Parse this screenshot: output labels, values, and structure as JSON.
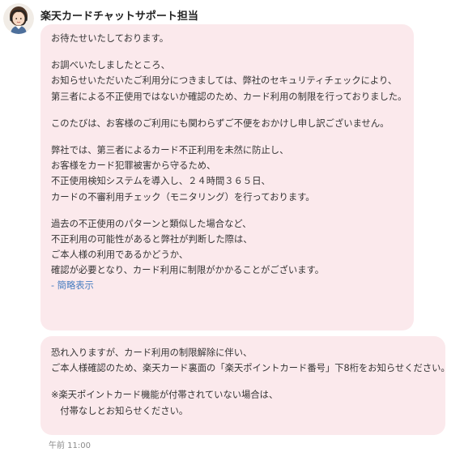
{
  "agent": {
    "name": "楽天カードチャットサポート担当",
    "avatar_icon": "support-agent-avatar-icon"
  },
  "messages": [
    {
      "paragraphs": [
        [
          "お待たせいたしております。"
        ],
        [
          "お調べいたしましたところ、",
          "お知らせいただいたご利用分につきましては、弊社のセキュリティチェックにより、",
          "第三者による不正使用ではないか確認のため、カード利用の制限を行っておりました。"
        ],
        [
          "このたびは、お客様のご利用にも関わらずご不便をおかけし申し訳ございません。"
        ],
        [
          "弊社では、第三者によるカード不正利用を未然に防止し、",
          "お客様をカード犯罪被害から守るため、",
          "不正使用検知システムを導入し、２４時間３６５日、",
          "カードの不審利用チェック（モニタリング）を行っております。"
        ],
        [
          "過去の不正使用のパターンと類似した場合など、",
          "不正利用の可能性があると弊社が判断した際は、",
          "ご本人様の利用であるかどうか、",
          "確認が必要となり、カード利用に制限がかかることがございます。"
        ]
      ],
      "collapse_link": "- 簡略表示"
    },
    {
      "paragraphs": [
        [
          "恐れ入りますが、カード利用の制限解除に伴い、",
          "ご本人様確認のため、楽天カード裏面の「楽天ポイントカード番号」下8桁をお知らせください。"
        ],
        [
          "※楽天ポイントカード機能が付帯されていない場合は、",
          "　付帯なしとお知らせください。"
        ]
      ]
    }
  ],
  "timestamp": "午前 11:00",
  "colors": {
    "bubble_background": "#fbe9ec",
    "link": "#4a7fc1",
    "text": "#333333",
    "timestamp": "#8a8a8a"
  }
}
